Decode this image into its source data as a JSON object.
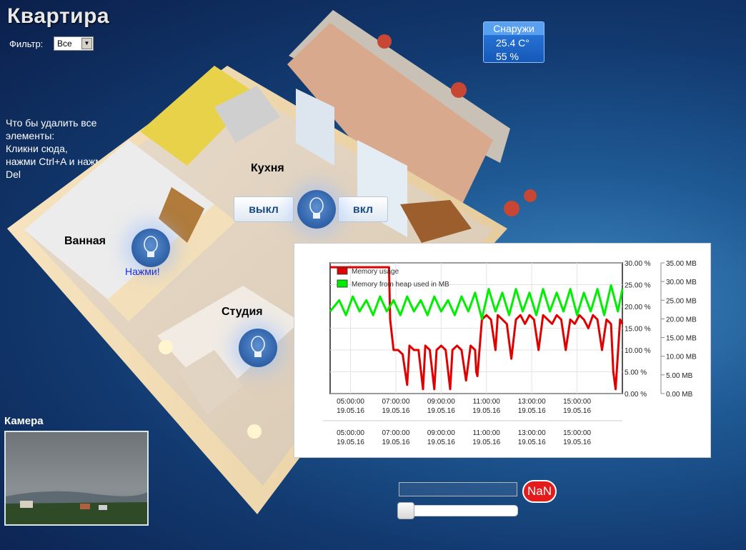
{
  "header": {
    "title": "Квартира",
    "filter_label": "Фильтр:",
    "filter_value": "Все"
  },
  "hint": {
    "lines": [
      "Что бы удалить все",
      "элементы:",
      "Кликни сюда,",
      "нажми Ctrl+A и нажми",
      "Del"
    ]
  },
  "outside": {
    "title": "Снаружи",
    "temperature": "25.4 C°",
    "humidity": "55 %"
  },
  "rooms": {
    "kitchen": {
      "label": "Кухня",
      "off_label": "выкл",
      "on_label": "вкл"
    },
    "bathroom": {
      "label": "Ванная",
      "press_label": "Нажми!"
    },
    "studio": {
      "label": "Студия"
    }
  },
  "camera": {
    "title": "Камера"
  },
  "controls": {
    "slider_input_value": "",
    "badge": "NaN",
    "slider_value": 0
  },
  "icons": {
    "bulb": "light-bulb-icon",
    "dropdown": "dropdown-arrow-icon"
  },
  "chart_data": {
    "type": "line",
    "legend": [
      "Memory usage",
      "Memory from heap used in MB"
    ],
    "x_ticks": [
      "05:00:00\n19.05.16",
      "07:00:00\n19.05.16",
      "09:00:00\n19.05.16",
      "11:00:00\n19.05.16",
      "13:00:00\n19.05.16",
      "15:00:00\n19.05.16"
    ],
    "y_left_ticks": [
      "30.00 %",
      "25.00 %",
      "20.00 %",
      "15.00 %",
      "10.00 %",
      "5.00 %",
      "0.00 %"
    ],
    "y_right_ticks": [
      "35.00 MB",
      "30.00 MB",
      "25.00 MB",
      "20.00 MB",
      "15.00 MB",
      "10.00 MB",
      "5.00 MB",
      "0.00 MB"
    ],
    "y_left_range": [
      0,
      30
    ],
    "y_right_range": [
      0,
      35
    ],
    "x_range": [
      4.1,
      17.0
    ],
    "colors": {
      "memory": "#e00000",
      "heap": "#00ee00"
    },
    "series": [
      {
        "name": "Memory usage",
        "axis": "left",
        "x": [
          4.1,
          4.4,
          4.6,
          4.8,
          5.0,
          5.3,
          5.6,
          5.9,
          6.2,
          6.5,
          6.7,
          6.75,
          6.9,
          7.1,
          7.3,
          7.5,
          7.6,
          7.8,
          8.0,
          8.2,
          8.3,
          8.5,
          8.7,
          8.8,
          9.0,
          9.2,
          9.4,
          9.5,
          9.7,
          9.9,
          10.1,
          10.3,
          10.5,
          10.55,
          10.6,
          10.8,
          11.0,
          11.2,
          11.4,
          11.5,
          11.7,
          11.9,
          12.1,
          12.3,
          12.5,
          12.7,
          12.9,
          13.1,
          13.3,
          13.5,
          13.7,
          13.9,
          14.1,
          14.3,
          14.5,
          14.7,
          14.9,
          15.1,
          15.3,
          15.5,
          15.7,
          15.9,
          16.1,
          16.3,
          16.5,
          16.6,
          16.7,
          16.9,
          17.0
        ],
        "y": [
          29,
          29,
          29,
          29,
          29,
          29,
          29,
          29,
          29,
          29,
          29,
          17,
          10,
          10,
          9,
          2,
          11,
          10,
          10,
          1,
          11,
          10,
          1,
          10,
          11,
          10,
          1,
          10,
          11,
          10,
          3,
          11,
          10,
          5,
          4,
          17,
          18,
          17,
          10,
          18,
          17,
          16,
          8,
          17,
          18,
          16,
          18,
          17,
          10,
          18,
          17,
          16,
          18,
          17,
          10,
          17,
          16,
          18,
          17,
          15,
          18,
          17,
          10,
          17,
          16,
          5,
          1,
          17,
          16
        ]
      },
      {
        "name": "Memory from heap used in MB",
        "axis": "right",
        "x": [
          4.1,
          4.5,
          4.8,
          5.1,
          5.4,
          5.7,
          6.0,
          6.3,
          6.6,
          6.9,
          7.2,
          7.5,
          7.8,
          8.1,
          8.4,
          8.7,
          9.0,
          9.3,
          9.6,
          9.9,
          10.2,
          10.5,
          10.8,
          11.1,
          11.4,
          11.7,
          12.0,
          12.3,
          12.6,
          12.9,
          13.2,
          13.5,
          13.8,
          14.1,
          14.4,
          14.7,
          15.0,
          15.3,
          15.6,
          15.9,
          16.2,
          16.5,
          16.8,
          17.0
        ],
        "y": [
          22,
          25,
          21,
          26,
          22,
          25,
          21,
          26,
          22,
          25,
          21,
          26,
          22,
          25,
          21,
          26,
          22,
          25,
          21,
          26,
          22,
          27,
          20,
          28,
          22,
          27,
          21,
          28,
          22,
          27,
          21,
          28,
          22,
          27,
          22,
          28,
          21,
          27,
          22,
          28,
          21,
          29,
          22,
          28
        ]
      }
    ]
  }
}
